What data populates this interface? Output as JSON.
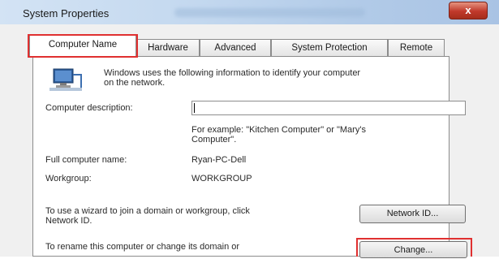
{
  "window": {
    "title": "System Properties",
    "close_label": "x"
  },
  "tabs": [
    {
      "label": "Computer Name",
      "active": true
    },
    {
      "label": "Hardware",
      "active": false
    },
    {
      "label": "Advanced",
      "active": false
    },
    {
      "label": "System Protection",
      "active": false
    },
    {
      "label": "Remote",
      "active": false
    }
  ],
  "computer_name": {
    "intro_line1": "Windows uses the following information to identify your computer",
    "intro_line2": "on the network.",
    "description_label": "Computer description:",
    "description_value": "",
    "example_line1": "For example: \"Kitchen Computer\" or \"Mary's",
    "example_line2": "Computer\".",
    "full_name_label": "Full computer name:",
    "full_name_value": "Ryan-PC-Dell",
    "workgroup_label": "Workgroup:",
    "workgroup_value": "WORKGROUP",
    "network_text_line1": "To use a wizard to join a domain or workgroup, click",
    "network_text_line2": "Network ID.",
    "network_id_button": "Network ID...",
    "rename_text": "To rename this computer or change its domain or",
    "change_button": "Change..."
  },
  "colors": {
    "highlight": "#e03030",
    "titlebar": "#c3d8ef"
  },
  "icons": {
    "computer": "computer-network-icon"
  }
}
